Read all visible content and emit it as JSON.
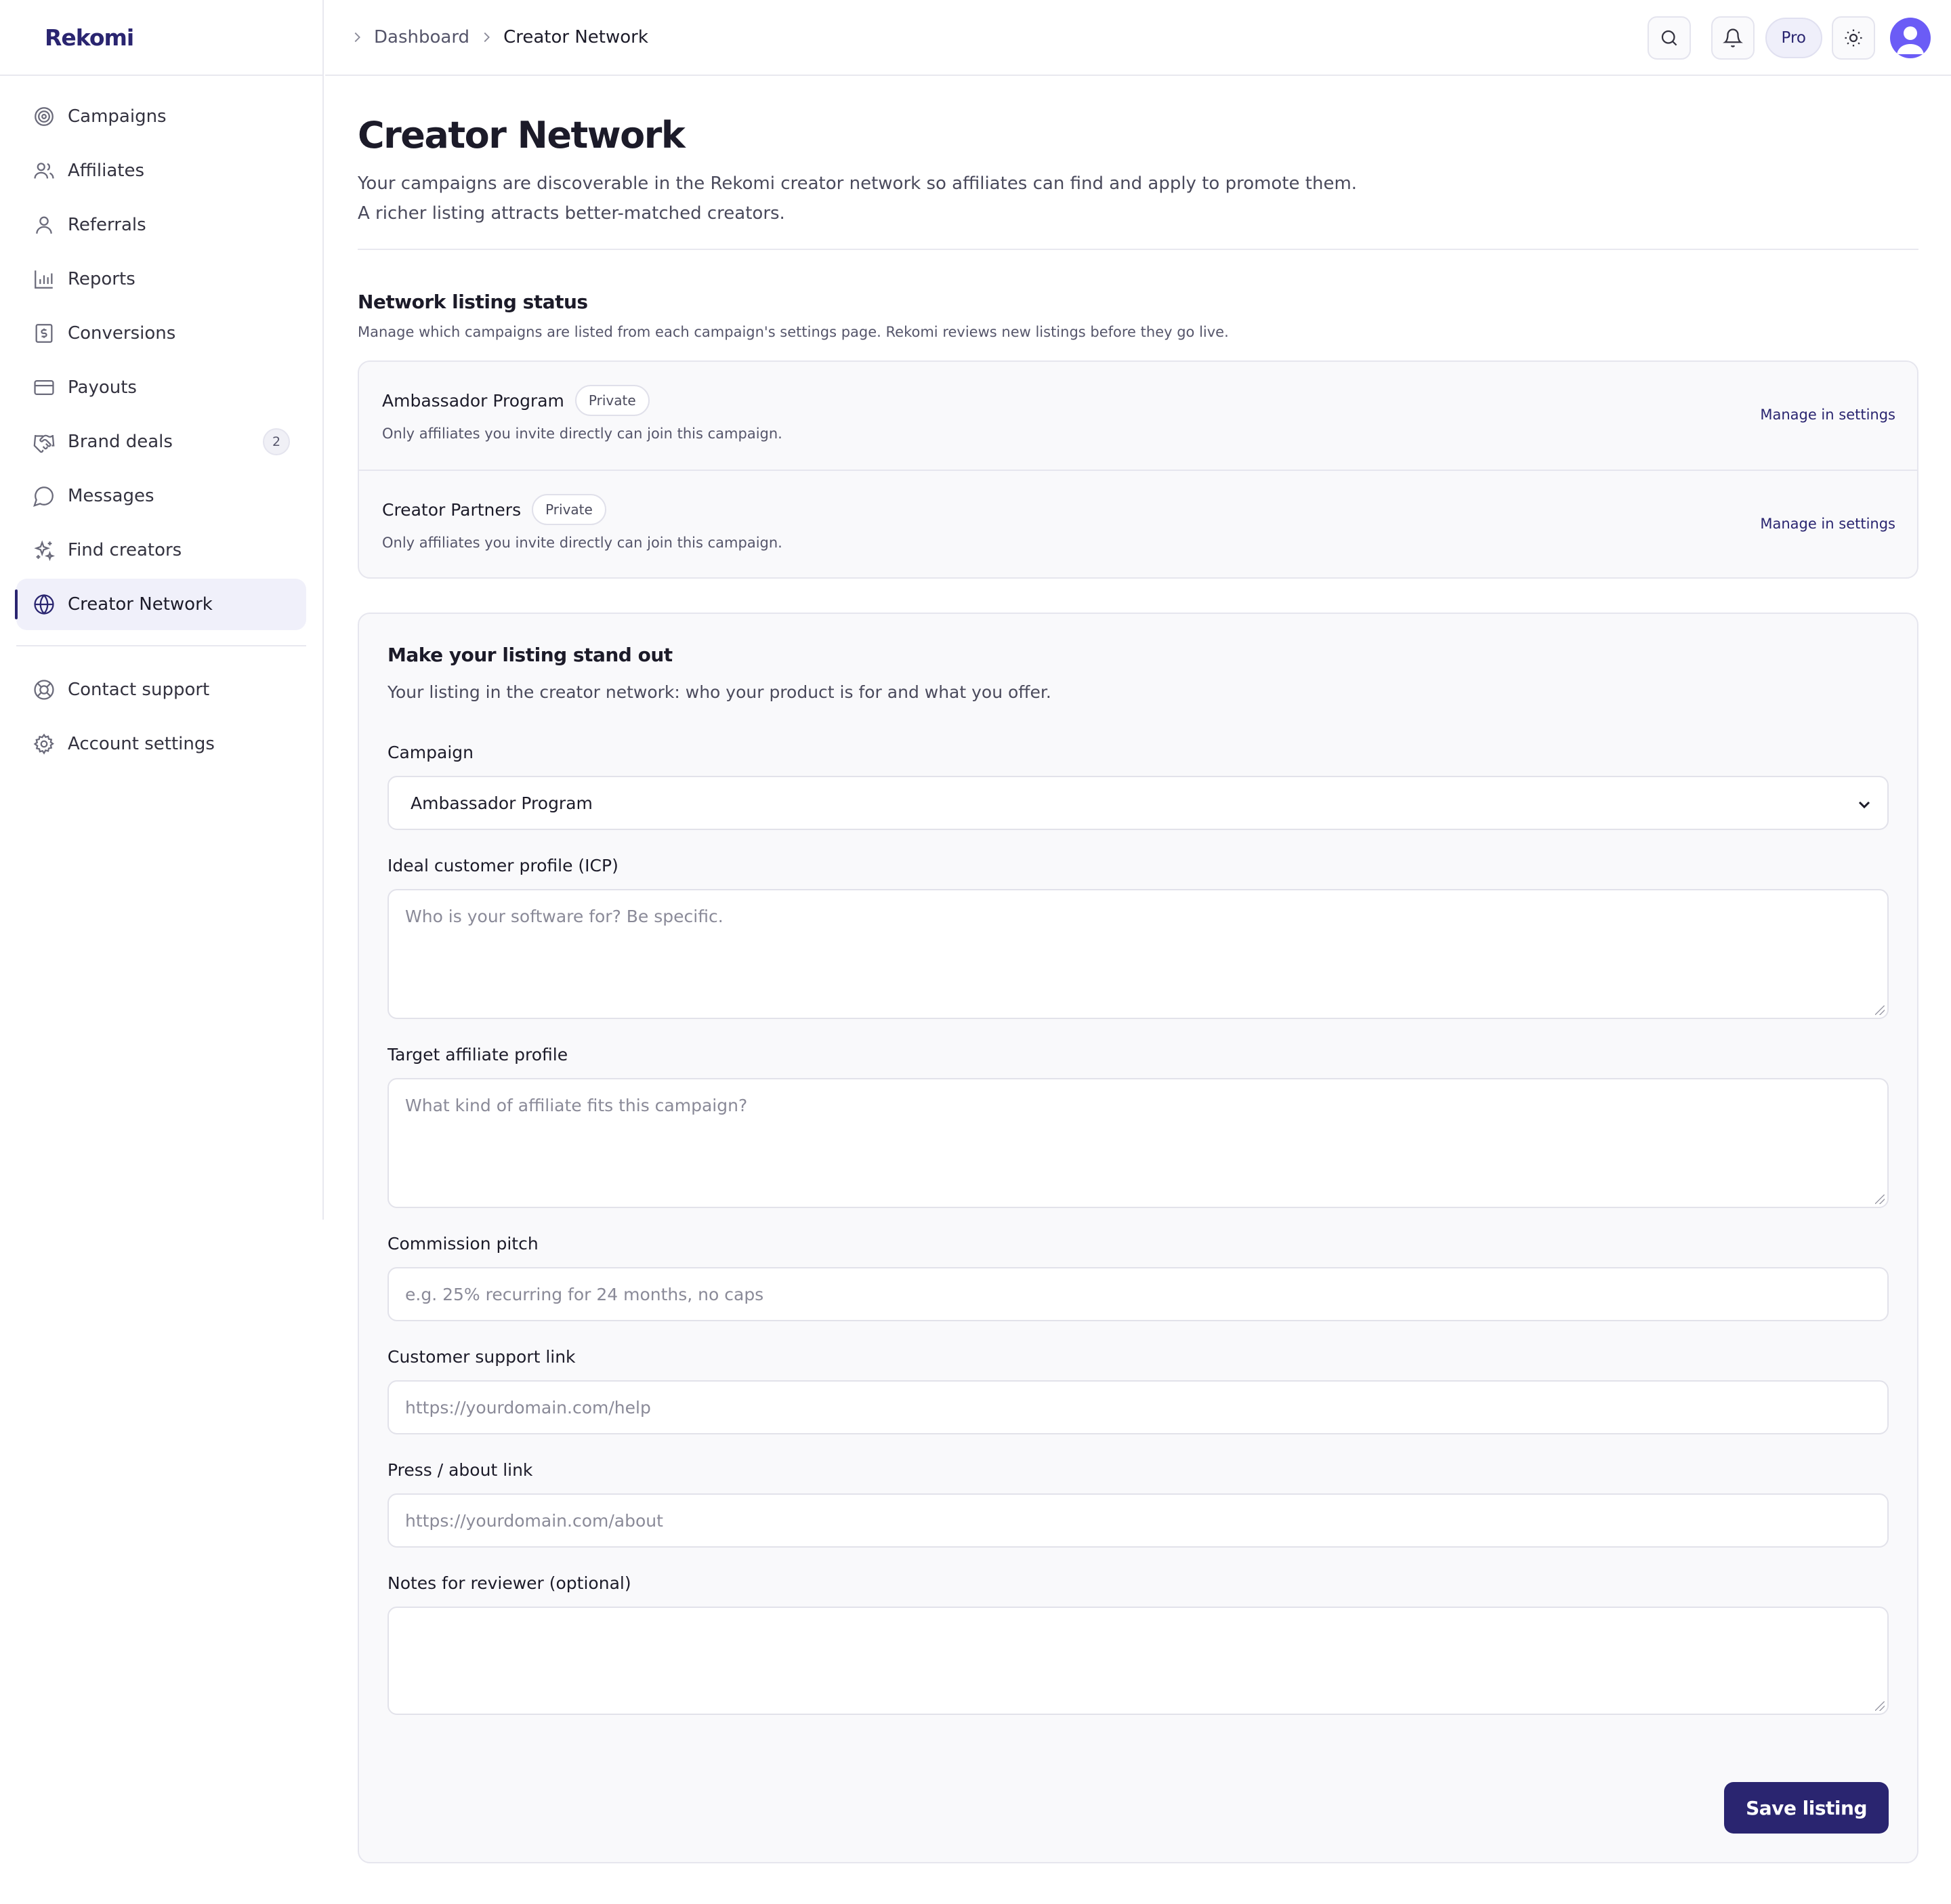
{
  "app": {
    "logo_text": "Rekomi",
    "accent": "#2a2570",
    "avatar_color": "#6b5cf6"
  },
  "sidebar": {
    "items": [
      {
        "label": "Campaigns",
        "icon": "target-icon"
      },
      {
        "label": "Affiliates",
        "icon": "users-icon"
      },
      {
        "label": "Referrals",
        "icon": "user-icon"
      },
      {
        "label": "Reports",
        "icon": "bar-chart-icon"
      },
      {
        "label": "Conversions",
        "icon": "receipt-icon"
      },
      {
        "label": "Payouts",
        "icon": "credit-card-icon"
      },
      {
        "label": "Brand deals",
        "icon": "handshake-icon",
        "badge": "2"
      },
      {
        "label": "Messages",
        "icon": "message-icon"
      },
      {
        "label": "Find creators",
        "icon": "sparkles-icon"
      },
      {
        "label": "Creator Network",
        "icon": "globe-icon",
        "active": true
      }
    ],
    "footer_items": [
      {
        "label": "Contact support",
        "icon": "lifebuoy-icon"
      },
      {
        "label": "Account settings",
        "icon": "gear-icon"
      }
    ]
  },
  "header": {
    "breadcrumb": [
      "Dashboard",
      "Creator Network"
    ],
    "plan_label": "Pro"
  },
  "page": {
    "title": "Creator Network",
    "description_line1": "Your campaigns are discoverable in the Rekomi creator network so affiliates can find and apply to promote them.",
    "description_line2": "A richer listing attracts better-matched creators."
  },
  "status": {
    "title": "Network listing status",
    "description": "Manage which campaigns are listed from each campaign's settings page. Rekomi reviews new listings before they go live.",
    "rows": [
      {
        "name": "Ambassador Program",
        "pill": "Private",
        "description": "Only affiliates you invite directly can join this campaign.",
        "link": "Manage in settings"
      },
      {
        "name": "Creator Partners",
        "pill": "Private",
        "description": "Only affiliates you invite directly can join this campaign.",
        "link": "Manage in settings"
      }
    ]
  },
  "form": {
    "title": "Make your listing stand out",
    "description": "Your listing in the creator network: who your product is for and what you offer.",
    "campaign_label": "Campaign",
    "campaign_value": "Ambassador Program",
    "icp_label": "Ideal customer profile (ICP)",
    "icp_placeholder": "Who is your software for? Be specific.",
    "affiliate_label": "Target affiliate profile",
    "affiliate_placeholder": "What kind of affiliate fits this campaign?",
    "commission_label": "Commission pitch",
    "commission_placeholder": "e.g. 25% recurring for 24 months, no caps",
    "support_label": "Customer support link",
    "support_placeholder": "https://yourdomain.com/help",
    "press_label": "Press / about link",
    "press_placeholder": "https://yourdomain.com/about",
    "notes_label": "Notes for reviewer (optional)",
    "save_label": "Save listing"
  }
}
